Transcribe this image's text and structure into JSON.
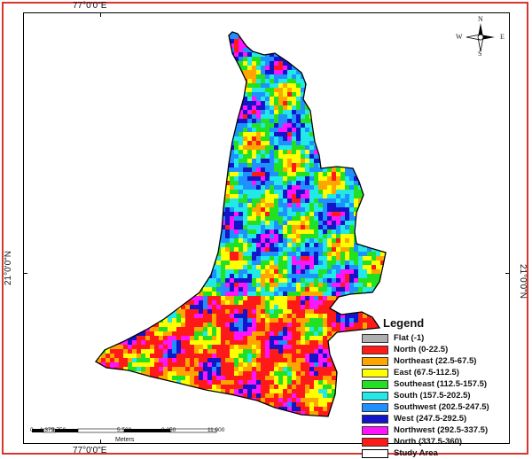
{
  "coordinates": {
    "top": "77°0'0\"E",
    "bottom": "77°0'0\"E",
    "left": "21°0'0\"N",
    "right": "21°0'0\"N"
  },
  "north_arrow": {
    "n": "N",
    "s": "S",
    "e": "E",
    "w": "W"
  },
  "legend": {
    "title": "Legend",
    "items": [
      {
        "label": "Flat (-1)",
        "color": "#b0b0b0"
      },
      {
        "label": "North (0-22.5)",
        "color": "#ff1a1a"
      },
      {
        "label": "Northeast (22.5-67.5)",
        "color": "#ffa500"
      },
      {
        "label": "East (67.5-112.5)",
        "color": "#ffff00"
      },
      {
        "label": "Southeast (112.5-157.5)",
        "color": "#22e022"
      },
      {
        "label": "South (157.5-202.5)",
        "color": "#22e8e8"
      },
      {
        "label": "Southwest (202.5-247.5)",
        "color": "#1e90ff"
      },
      {
        "label": "West (247.5-292.5)",
        "color": "#1414c8"
      },
      {
        "label": "Northwest (292.5-337.5)",
        "color": "#ff14ff"
      },
      {
        "label": "North (337.5-360)",
        "color": "#ff1a1a"
      },
      {
        "label": "Study Area",
        "color": "#ffffff"
      }
    ]
  },
  "scale": {
    "ticks": [
      "0",
      "1,375",
      "2,750",
      "5,500",
      "8,250",
      "11,000"
    ],
    "unit": "Meters"
  }
}
